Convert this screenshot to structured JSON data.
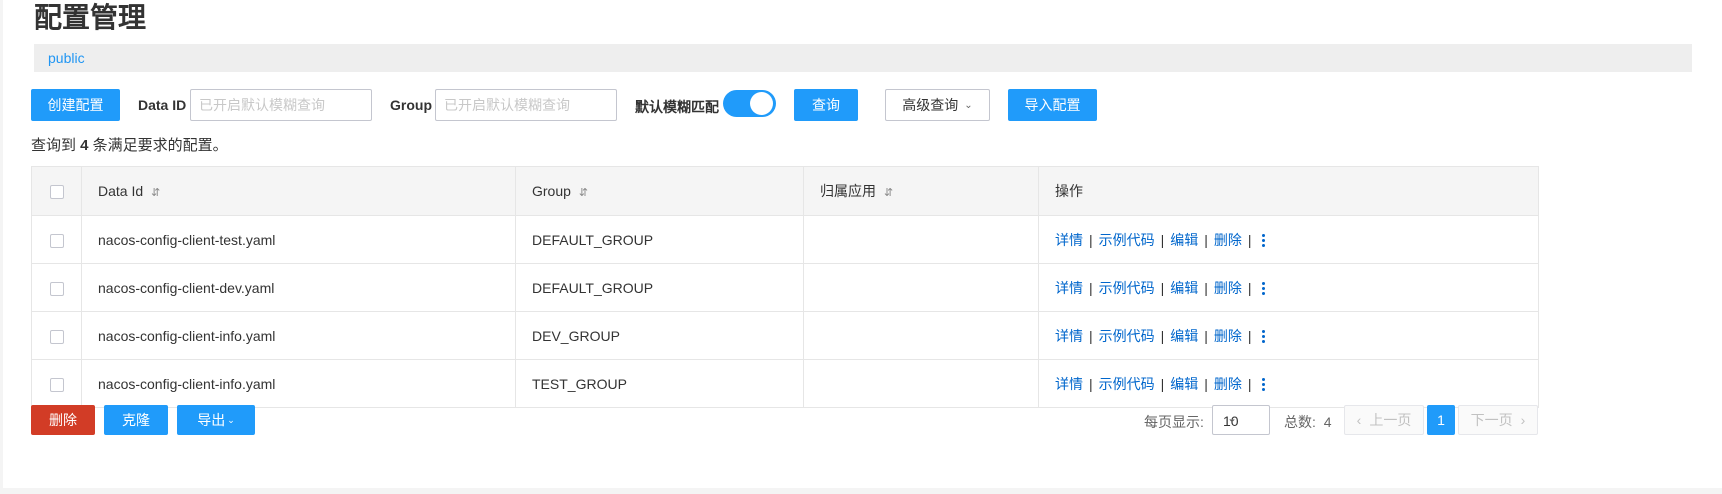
{
  "page": {
    "title": "配置管理",
    "namespace": "public"
  },
  "toolbar": {
    "create_label": "创建配置",
    "data_id_label": "Data ID",
    "data_id_placeholder": "已开启默认模糊查询",
    "group_label": "Group",
    "group_placeholder": "已开启默认模糊查询",
    "fuzzy_label": "默认模糊匹配",
    "fuzzy_enabled": true,
    "query_label": "查询",
    "advanced_label": "高级查询",
    "import_label": "导入配置"
  },
  "summary": {
    "prefix": "查询到 ",
    "count": "4",
    "suffix": " 条满足要求的配置。"
  },
  "table": {
    "columns": [
      "Data Id",
      "Group",
      "归属应用",
      "操作"
    ],
    "rows": [
      {
        "data_id": "nacos-config-client-test.yaml",
        "group": "DEFAULT_GROUP",
        "app": ""
      },
      {
        "data_id": "nacos-config-client-dev.yaml",
        "group": "DEFAULT_GROUP",
        "app": ""
      },
      {
        "data_id": "nacos-config-client-info.yaml",
        "group": "DEV_GROUP",
        "app": ""
      },
      {
        "data_id": "nacos-config-client-info.yaml",
        "group": "TEST_GROUP",
        "app": ""
      }
    ],
    "actions": [
      "详情",
      "示例代码",
      "编辑",
      "删除"
    ],
    "separator": "|"
  },
  "footer": {
    "delete_label": "删除",
    "clone_label": "克隆",
    "export_label": "导出",
    "page_size_label": "每页显示:",
    "page_size": "10",
    "total_label": "总数:",
    "total": "4",
    "prev_label": "上一页",
    "current_page": "1",
    "next_label": "下一页"
  },
  "colors": {
    "primary": "#209bfa",
    "danger": "#d23c26",
    "link": "#0066cc"
  },
  "icons": [
    "sort-icon",
    "chevron-down-icon",
    "more-vertical-icon",
    "chevron-left-icon",
    "chevron-right-icon"
  ]
}
